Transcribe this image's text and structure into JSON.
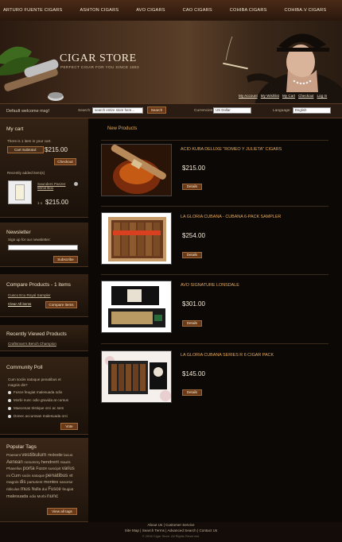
{
  "topnav": [
    "ARTURO FUENTE CIGARS",
    "ASHTON CIGARS",
    "AVO CIGARS",
    "CAO CIGARS",
    "COHIBA CIGARS",
    "COHIBA.V CIGARS"
  ],
  "banner": {
    "brand": "CIGAR STORE",
    "tagline": "PERFECT CIGAR FOR YOU SINCE 1883",
    "links": [
      "My Account",
      "My Wishlist",
      "My Cart",
      "Checkout",
      "Log In"
    ]
  },
  "bar": {
    "welcome": "Default welcome msg!",
    "search_label": "Search:",
    "search_value": "search entire store here...",
    "search_btn": "Search",
    "currency_label": "Currencies:",
    "currency_value": "US Dollar",
    "language_label": "Language:",
    "language_value": "English"
  },
  "cart": {
    "title": "My cart",
    "text": "There is 1 item in your cart.",
    "subtotal_label": "Cart Subtotal:",
    "subtotal": "$215.00",
    "checkout": "Checkout",
    "recent_label": "Recently added item(s)",
    "item_name": "Saunders Panzer 50mil Box",
    "item_qty": "1 x",
    "item_price": "$215.00"
  },
  "newsletter": {
    "title": "Newsletter",
    "signup": "Sign up for our newsletter:",
    "subscribe": "Subscribe"
  },
  "compare": {
    "title": "Compare Products - 1 items",
    "item": "Cusco Ecu Royal Sampler",
    "clear": "Clear All items",
    "btn": "Compare items"
  },
  "viewed": {
    "title": "Recently Viewed Products",
    "item": "Craftsman's Bench Champion"
  },
  "poll": {
    "title": "Community Poll",
    "question": "Cum sociis natoque penatibus et magnis dis?",
    "options": [
      "Fusce feugiat malesuada odio",
      "Morbi nunc odio gravida at cursus",
      "Maecenas tristique orci ac sem",
      "Donec accumsan malesuada orci"
    ],
    "vote": "Vote"
  },
  "tags": {
    "title": "Popular Tags",
    "words": [
      "Praesent",
      "vestibulum",
      "molestie",
      "lacus",
      "Aenean",
      "nonummy",
      "hendrerit",
      "mauris",
      "Phasellus",
      "porta",
      "Fusce",
      "suscipit",
      "varius",
      "mi",
      "Cum",
      "sociis",
      "natoque",
      "penatibus",
      "et",
      "magnis",
      "dis",
      "parturient",
      "montes",
      "nascetur",
      "ridiculus",
      "mus",
      "Nulla",
      "dui",
      "Fusce",
      "feugiat",
      "malesuada",
      "odio",
      "Morbi",
      "nunc"
    ],
    "all": "View all tags"
  },
  "main": {
    "heading": "New Products",
    "products": [
      {
        "name": "ACID KUBA DELUXE \"ROMEO Y JULIETA\" CIGARS",
        "price": "$215.00",
        "detail": "Details"
      },
      {
        "name": "LA GLORIA CUBANA - CUBANA 6-PACK SAMPLER",
        "price": "$254.00",
        "detail": "Details"
      },
      {
        "name": "AVO SIGNATURE LONSDALE",
        "price": "$301.00",
        "detail": "Details"
      },
      {
        "name": "LA GLORIA CUBANA SERIES R 6 CIGAR PACK",
        "price": "$145.00",
        "detail": "Details"
      }
    ]
  },
  "footer": {
    "row1": [
      "About Us",
      "Customer Service"
    ],
    "row2": [
      "Site Map",
      "Search Terms",
      "Advanced Search",
      "Contact Us"
    ],
    "copy": "© 2008 Cigar Store. All Rights Reserved."
  }
}
